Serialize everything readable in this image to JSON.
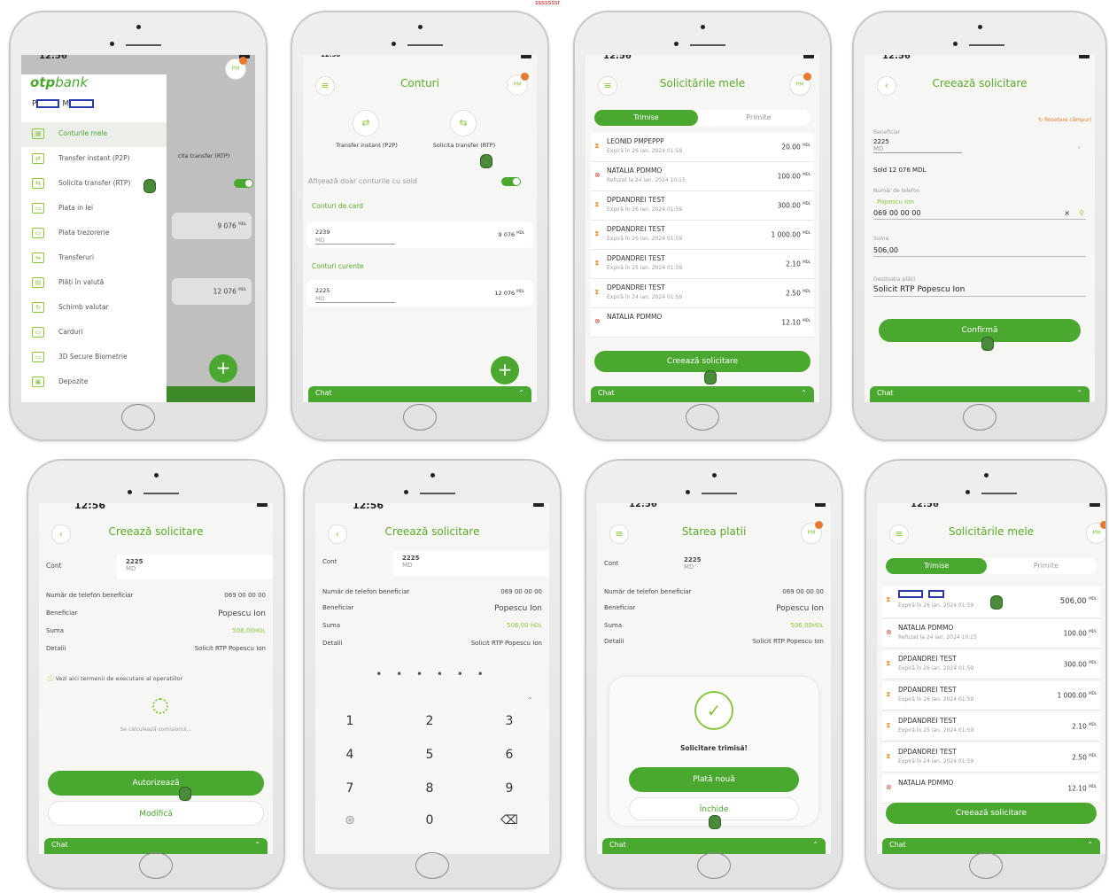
{
  "top_marker": "sssssssr",
  "time": "12:56",
  "avatar": "PM",
  "chat": "Chat",
  "s1": {
    "logo_b": "otp",
    "logo_l": "bank",
    "user_l": "P",
    "user_r": "M",
    "items": [
      "Conturile mele",
      "Transfer instant (P2P)",
      "Solicita transfer (RTP)",
      "Plata in lei",
      "Plata trezorerie",
      "Transferuri",
      "Plăți în valută",
      "Schimb valutar",
      "Carduri",
      "3D Secure Biometrie",
      "Depozite"
    ],
    "behind_label": "cita transfer (RTP)",
    "behind_a1": "9 076",
    "behind_a2": "12 076",
    "cur": "MDL"
  },
  "s2": {
    "title": "Conturi",
    "qa1": "Transfer instant (P2P)",
    "qa2": "Solicita transfer (RTP)",
    "filter": "Afișează doar conturile cu sold",
    "card_sec": "Conturi de card",
    "acc1": "2239",
    "acc1_amt": "9 076",
    "cur_sec": "Conturi curente",
    "acc2": "2225",
    "acc2_amt": "12 076",
    "md": "MD",
    "cur": "MDL"
  },
  "s3": {
    "title": "Solicitările mele",
    "tab_on": "Trimise",
    "tab_off": "Primite",
    "rows": [
      {
        "n": "LEONID PMPEPPP",
        "s": "Expiră în 26 ian. 2024 01:59",
        "a": "20.00"
      },
      {
        "n": "NATALIA PDMMO",
        "s": "Refuzat la 24 ian. 2024 10:15",
        "a": "100.00"
      },
      {
        "n": "DPDANDREI TEST",
        "s": "Expiră în 26 ian. 2024 01:59",
        "a": "300.00"
      },
      {
        "n": "DPDANDREI TEST",
        "s": "Expiră în 26 ian. 2024 01:59",
        "a": "1 000.00"
      },
      {
        "n": "DPDANDREI TEST",
        "s": "Expiră în 25 ian. 2024 01:59",
        "a": "2.10"
      },
      {
        "n": "DPDANDREI TEST",
        "s": "Expiră în 24 ian. 2024 01:59",
        "a": "2.50"
      },
      {
        "n": "NATALIA PDMMO",
        "s": "",
        "a": "12.10"
      }
    ],
    "btn": "Creează solicitare",
    "cur": "MDL"
  },
  "s4": {
    "title": "Creează solicitare",
    "reset": "Resetare câmpuri",
    "l_ben": "Beneficiar",
    "v_ben": "2225",
    "v_md": "MD",
    "sold": "Sold 12 076 MDL",
    "l_tel": "Număr de telefon",
    "v_name": "Popescu Ion",
    "v_tel": "069 00 00 00",
    "l_sum": "Suma",
    "v_sum": "506,00",
    "l_dest": "Destinația plății",
    "v_dest": "Solicit RTP Popescu Ion",
    "btn": "Confirmă"
  },
  "s5": {
    "title": "Creează solicitare",
    "l_cont": "Cont",
    "v_cont": "2225",
    "v_md": "MD",
    "l_tel": "Număr de telefon beneficiar",
    "v_tel": "069 00 00 00",
    "l_ben": "Beneficiar",
    "v_ben": "Popescu Ion",
    "l_sum": "Suma",
    "v_sum": "506,00",
    "v_cur": "MDL",
    "l_det": "Detalii",
    "v_det": "Solicit RTP Popescu Ion",
    "terms": "Vezi aici termenii de executare al operatiilor",
    "calc": "Se calculează comisionul...",
    "btn1": "Autorizează",
    "btn2": "Modifică"
  },
  "s6": {
    "title": "Creează solicitare",
    "pin": "• • • • • •",
    "keys": [
      "1",
      "2",
      "3",
      "4",
      "5",
      "6",
      "7",
      "8",
      "9",
      "0"
    ]
  },
  "s7": {
    "title": "Starea platii",
    "sent": "Solicitare trimisă!",
    "btn1": "Plată nouă",
    "btn2": "Închide"
  },
  "s8": {
    "title": "Solicitările mele",
    "first_s": "Expiră în 26 ian. 2024 01:59",
    "first_a": "506,00",
    "btn": "Creează solicitare"
  }
}
